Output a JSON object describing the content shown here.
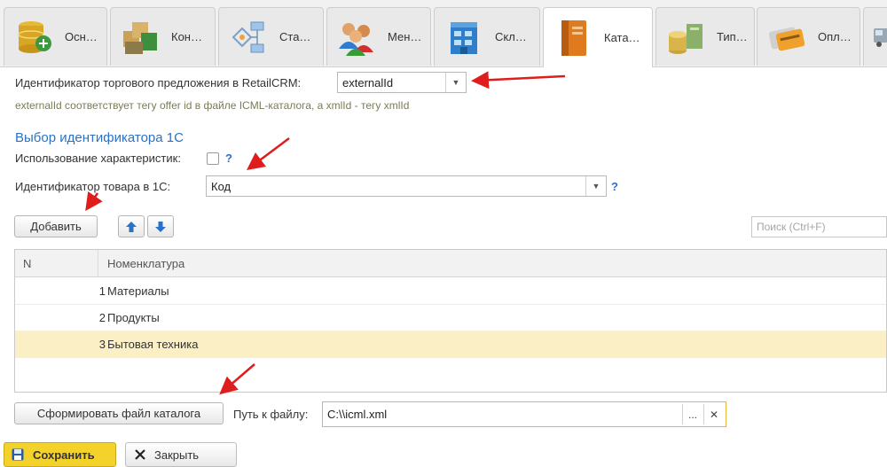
{
  "tabs": [
    {
      "label": "Осн…",
      "icon": "database-icon"
    },
    {
      "label": "Кон…",
      "icon": "boxes-icon"
    },
    {
      "label": "Ста…",
      "icon": "workflow-icon"
    },
    {
      "label": "Мен…",
      "icon": "users-icon"
    },
    {
      "label": "Скл…",
      "icon": "warehouse-icon"
    },
    {
      "label": "Ката…",
      "icon": "catalog-icon"
    },
    {
      "label": "Тип…",
      "icon": "coins-icon"
    },
    {
      "label": "Опл…",
      "icon": "credit-card-icon"
    },
    {
      "label": "",
      "icon": "truck-icon"
    }
  ],
  "offer_id": {
    "label": "Идентификатор торгового предложения в RetailCRM:",
    "value": "externalId",
    "hint": "externalId соответствует тегу offer id в файле ICML-каталога, а xmlId - тегу xmlId"
  },
  "section_title": "Выбор идентификатора 1С",
  "characteristics": {
    "label": "Использование характеристик:",
    "help": "?"
  },
  "product_id": {
    "label": "Идентификатор товара в 1С:",
    "value": "Код",
    "help": "?"
  },
  "toolbar": {
    "add_label": "Добавить",
    "search_placeholder": "Поиск (Ctrl+F)"
  },
  "table": {
    "columns": [
      "N",
      "Номенклатура"
    ],
    "rows": [
      {
        "n": "1",
        "name": "Материалы"
      },
      {
        "n": "2",
        "name": "Продукты"
      },
      {
        "n": "3",
        "name": "Бытовая техника"
      }
    ]
  },
  "generate": {
    "label": "Сформировать файл каталога"
  },
  "path": {
    "label": "Путь к файлу:",
    "value": "C:\\\\icml.xml",
    "browse": "...",
    "clear": "✕"
  },
  "footer": {
    "save_label": "Сохранить",
    "close_label": "Закрыть"
  },
  "colors": {
    "accent_blue": "#2a71c8",
    "save_yellow": "#f3d22b",
    "selected_row": "#fbefc6",
    "arrow_red": "#e01d1d"
  }
}
